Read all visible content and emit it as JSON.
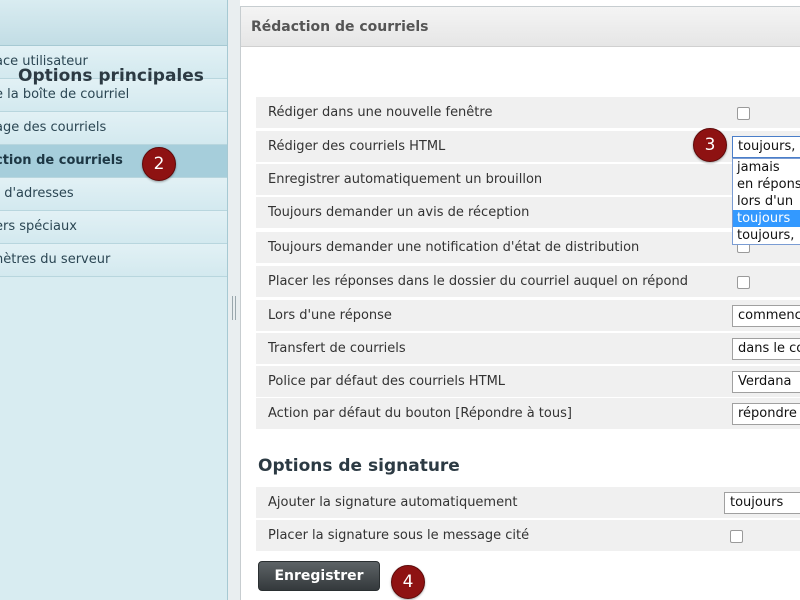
{
  "sidebar": {
    "items": [
      {
        "label": "ace utilisateur"
      },
      {
        "label": "e la boîte de courriel"
      },
      {
        "label": "age des courriels"
      },
      {
        "label": "ction de courriels"
      },
      {
        "label": "t d'adresses"
      },
      {
        "label": "ers spéciaux"
      },
      {
        "label": "nètres du serveur"
      }
    ]
  },
  "main": {
    "header": "Rédaction de courriels",
    "sections": {
      "main_options": {
        "title": "Options principales",
        "rows": [
          {
            "label": "Rédiger dans une nouvelle fenêtre"
          },
          {
            "label": "Rédiger des courriels HTML",
            "value": "toujours,"
          },
          {
            "label": "Enregistrer automatiquement un brouillon"
          },
          {
            "label": "Toujours demander un avis de réception"
          },
          {
            "label": "Toujours demander une notification d'état de distribution"
          },
          {
            "label": "Placer les réponses dans le dossier du courriel auquel on répond"
          },
          {
            "label": "Lors d'une réponse",
            "value": "commenc"
          },
          {
            "label": "Transfert de courriels",
            "value": "dans le co"
          },
          {
            "label": "Police par défaut des courriels HTML",
            "value": "Verdana"
          },
          {
            "label": "Action par défaut du bouton [Répondre à tous]",
            "value": "répondre"
          }
        ]
      },
      "signature_options": {
        "title": "Options de signature",
        "rows": [
          {
            "label": "Ajouter la signature automatiquement",
            "value": "toujours"
          },
          {
            "label": "Placer la signature sous le message cité"
          }
        ]
      }
    },
    "html_dropdown": {
      "options": [
        "jamais",
        "en répons",
        "lors d'un",
        "toujours",
        "toujours,"
      ],
      "selected": "toujours"
    },
    "save_label": "Enregistrer"
  },
  "markers": [
    "2",
    "3",
    "4"
  ],
  "colors": {
    "marker": "#8e1212",
    "sidebar_active": "#a6cedb",
    "dropdown_selected": "#3399ff"
  }
}
